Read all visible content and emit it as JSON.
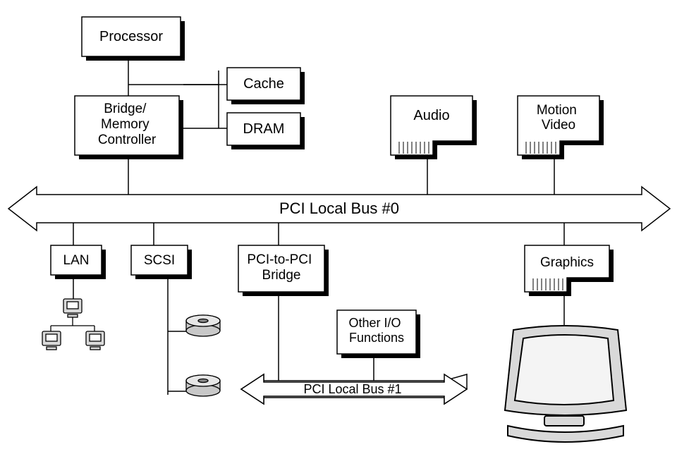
{
  "nodes": {
    "processor": "Processor",
    "bridge": "Bridge/\nMemory\nController",
    "cache": "Cache",
    "dram": "DRAM",
    "audio": "Audio",
    "motion": "Motion\nVideo",
    "lan": "LAN",
    "scsi": "SCSI",
    "pci_bridge": "PCI-to-PCI\nBridge",
    "other_io": "Other I/O\nFunctions",
    "graphics": "Graphics"
  },
  "buses": {
    "bus0": "PCI Local Bus #0",
    "bus1": "PCI Local Bus #1"
  }
}
